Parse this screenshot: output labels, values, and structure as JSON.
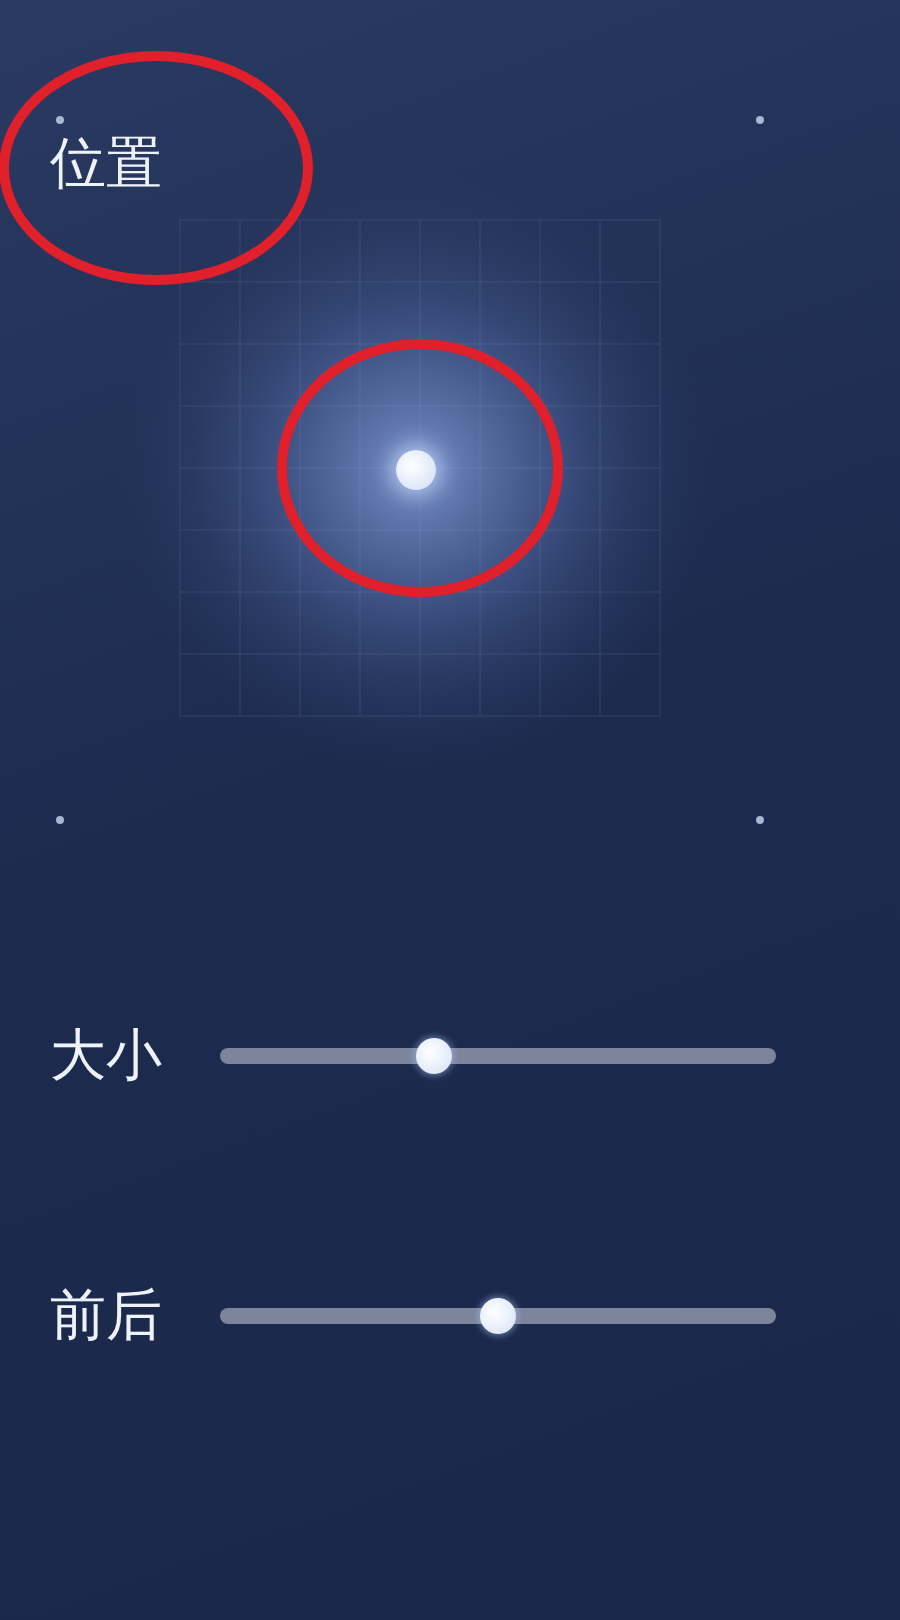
{
  "position": {
    "label": "位置"
  },
  "sliders": [
    {
      "label": "大小",
      "level": 0.385
    },
    {
      "label": "前后",
      "level": 0.5
    }
  ]
}
